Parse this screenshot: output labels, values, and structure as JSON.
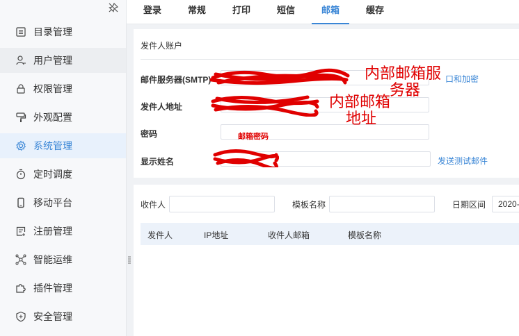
{
  "sidebar": {
    "items": [
      {
        "label": "目录管理",
        "icon": "list-icon"
      },
      {
        "label": "用户管理",
        "icon": "user-icon"
      },
      {
        "label": "权限管理",
        "icon": "lock-icon"
      },
      {
        "label": "外观配置",
        "icon": "brush-icon"
      },
      {
        "label": "系统管理",
        "icon": "gear-icon",
        "active": true
      },
      {
        "label": "定时调度",
        "icon": "stopwatch-icon"
      },
      {
        "label": "移动平台",
        "icon": "mobile-icon"
      },
      {
        "label": "注册管理",
        "icon": "register-icon"
      },
      {
        "label": "智能运维",
        "icon": "network-icon"
      },
      {
        "label": "插件管理",
        "icon": "puzzle-icon"
      },
      {
        "label": "安全管理",
        "icon": "shield-icon"
      }
    ]
  },
  "tabs": [
    {
      "label": "登录"
    },
    {
      "label": "常规"
    },
    {
      "label": "打印"
    },
    {
      "label": "短信"
    },
    {
      "label": "邮箱",
      "active": true
    },
    {
      "label": "缓存"
    }
  ],
  "mail_settings": {
    "section_title": "发件人账户",
    "smtp_label": "邮件服务器(SMTP)",
    "smtp_link": "口和加密",
    "sender_address_label": "发件人地址",
    "password_label": "密码",
    "display_name_label": "显示姓名",
    "test_mail_link": "发送测试邮件"
  },
  "annotations": {
    "smtp_note_line1": "内部邮箱服",
    "smtp_note_line2": "务器",
    "address_note_line1": "内部邮箱",
    "address_note_line2": "地址",
    "password_note": "邮箱密码"
  },
  "filter": {
    "recipient_label": "收件人",
    "template_label": "模板名称",
    "date_label": "日期区间",
    "date_value": "2020-"
  },
  "table": {
    "headers": [
      "发件人",
      "IP地址",
      "收件人邮箱",
      "模板名称"
    ]
  },
  "colors": {
    "accent": "#3a86d6",
    "redaction": "#e00000"
  }
}
